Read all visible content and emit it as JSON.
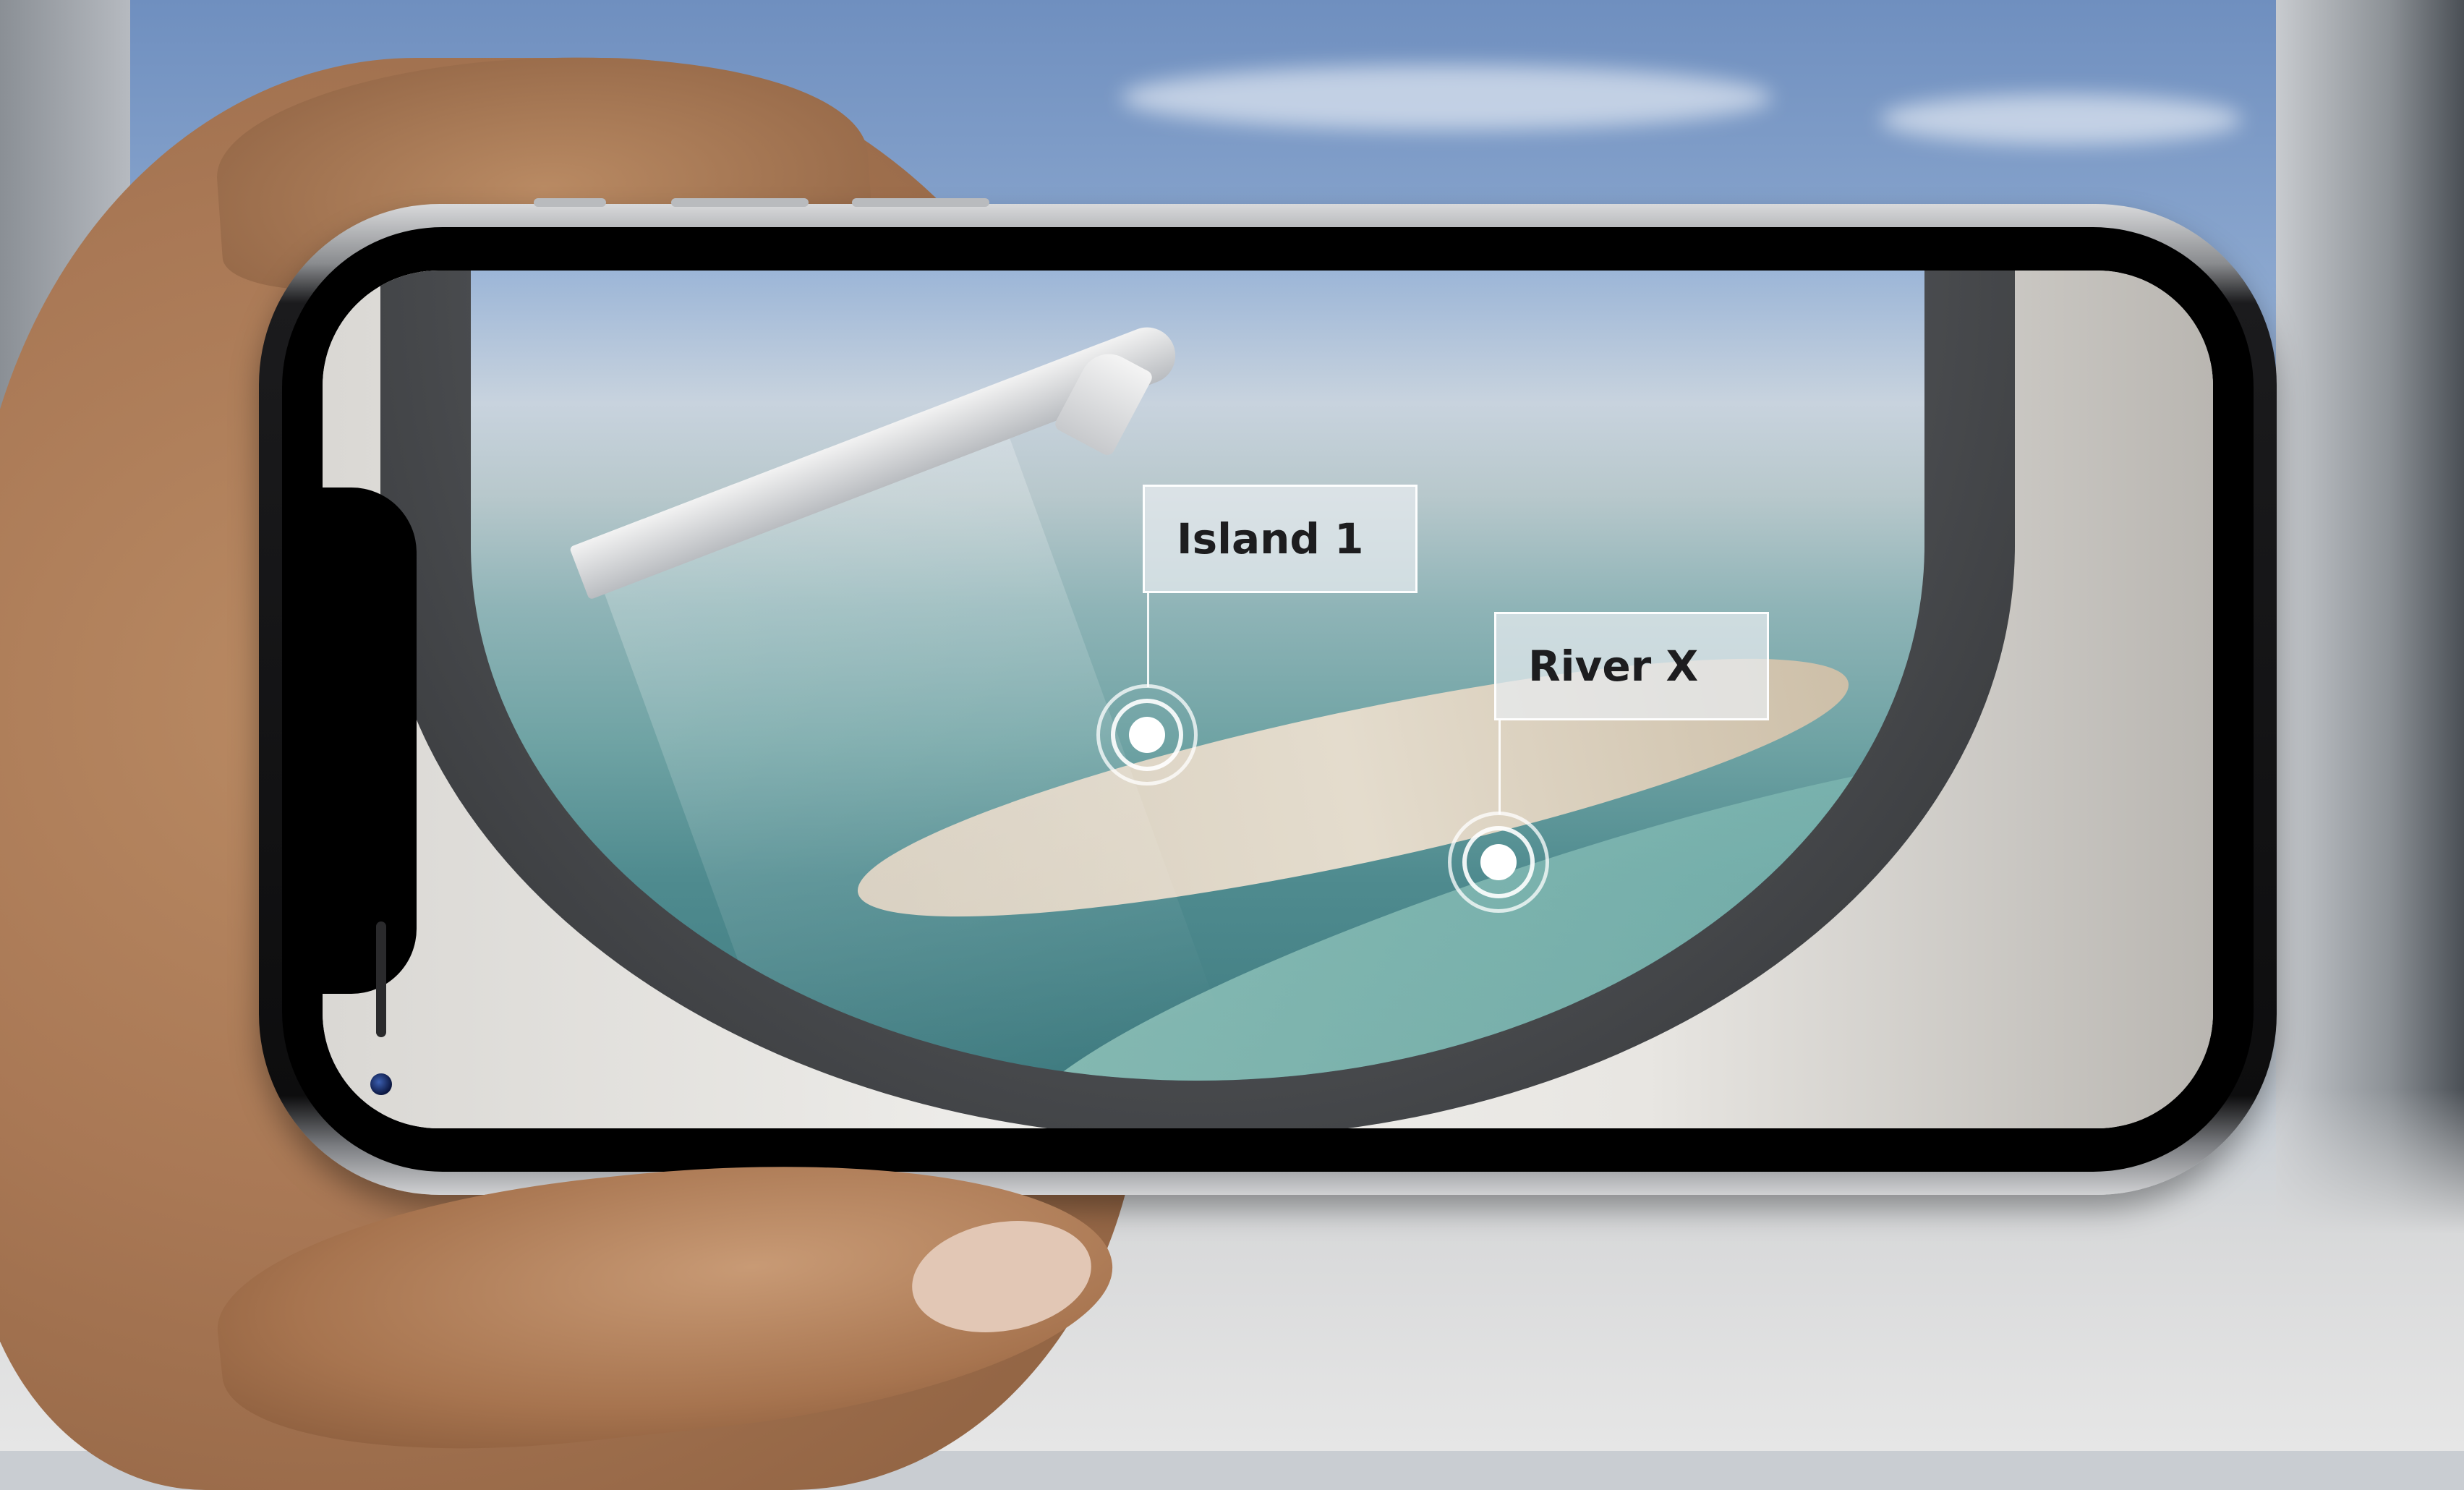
{
  "ar_view": {
    "annotations": [
      {
        "label": "Island 1"
      },
      {
        "label": "River X"
      }
    ]
  },
  "colors": {
    "label_background": "#e8ecf0",
    "label_text": "#1d1d1f",
    "marker": "#ffffff",
    "phone_frame": "#0d0d0e"
  },
  "icons": [
    "front-camera-icon",
    "map-pin-marker-icon"
  ]
}
